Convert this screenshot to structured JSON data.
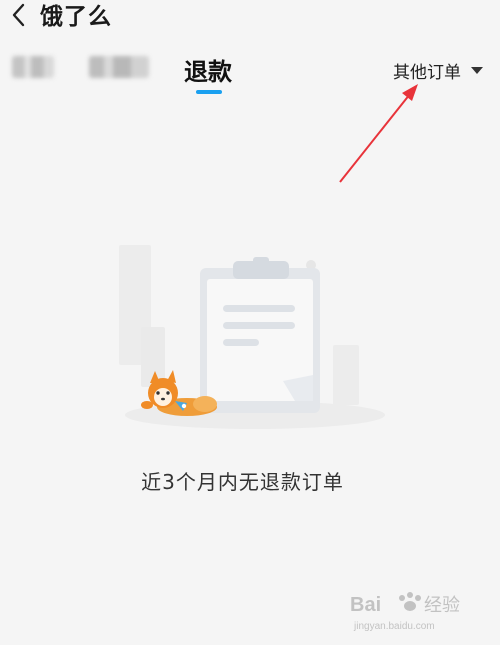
{
  "header": {
    "title": "饿了么",
    "back_icon": "chevron-left-icon"
  },
  "tabs": {
    "active_label": "退款",
    "other_orders_label": "其他订单",
    "other_orders_icon": "caret-down-icon",
    "indicator_color": "#1aa0f0"
  },
  "empty_state": {
    "message": "近3个月内无退款订单",
    "illustration": "clipboard-with-shiba-dog"
  },
  "annotation": {
    "color": "#e8333a"
  },
  "watermark": {
    "brand": "Baidu 经验",
    "url": "jingyan.baidu.com"
  }
}
